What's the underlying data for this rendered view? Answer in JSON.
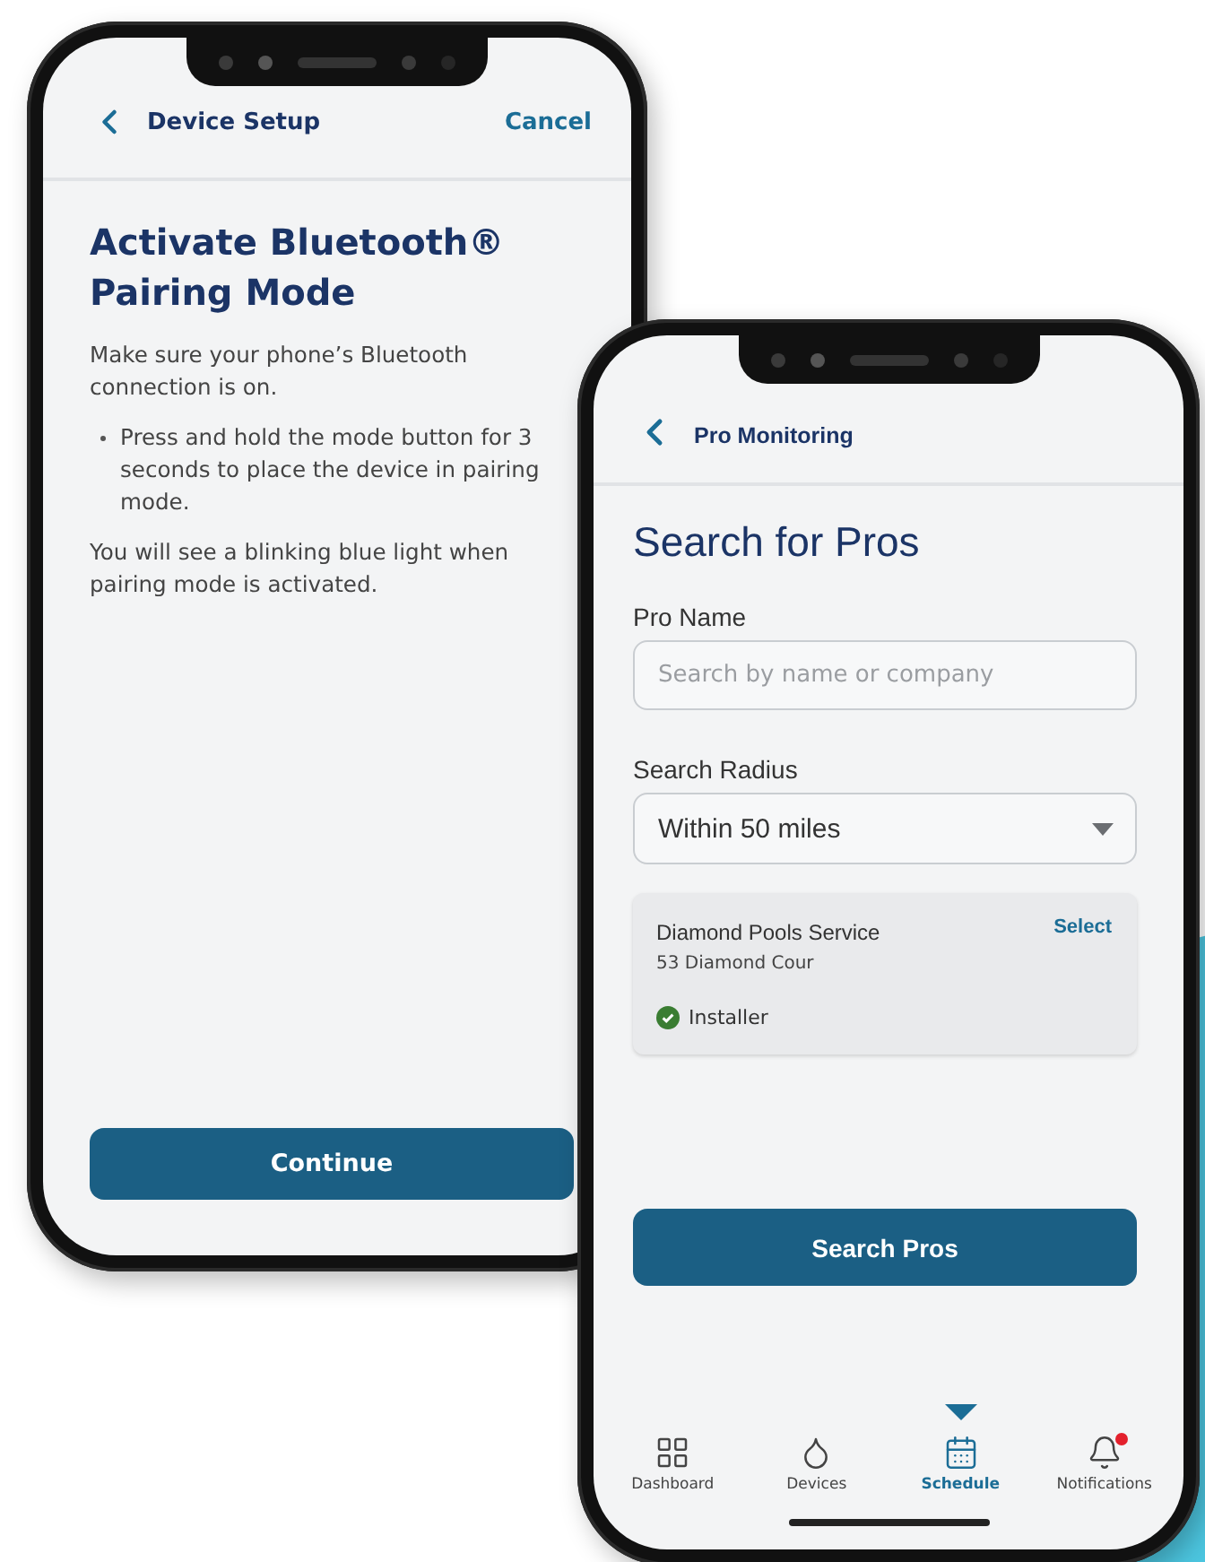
{
  "device_setup_screen": {
    "header": {
      "title": "Device Setup",
      "action": "Cancel"
    },
    "heading": "Activate Bluetooth® Pairing Mode",
    "intro": "Make sure your phone’s Bluetooth connection is on.",
    "bullets": [
      "Press and hold the mode button for 3 seconds to place the device in pairing mode."
    ],
    "note": "You will see a blinking blue light when pairing mode is activated.",
    "primary_button": "Continue"
  },
  "pro_search_screen": {
    "header": {
      "title": "Pro Monitoring"
    },
    "heading": "Search for Pros",
    "pro_name": {
      "label": "Pro Name",
      "placeholder": "Search by name or company"
    },
    "search_radius": {
      "label": "Search Radius",
      "value": "Within 50 miles"
    },
    "results": [
      {
        "name": "Diamond Pools Service",
        "address": "53 Diamond Cour",
        "tag": "Installer",
        "action": "Select"
      }
    ],
    "primary_button": "Search Pros",
    "tabs": [
      {
        "label": "Dashboard",
        "selected": false,
        "alert": false
      },
      {
        "label": "Devices",
        "selected": false,
        "alert": false
      },
      {
        "label": "Schedule",
        "selected": true,
        "alert": false
      },
      {
        "label": "Notifications",
        "selected": false,
        "alert": true
      }
    ]
  }
}
